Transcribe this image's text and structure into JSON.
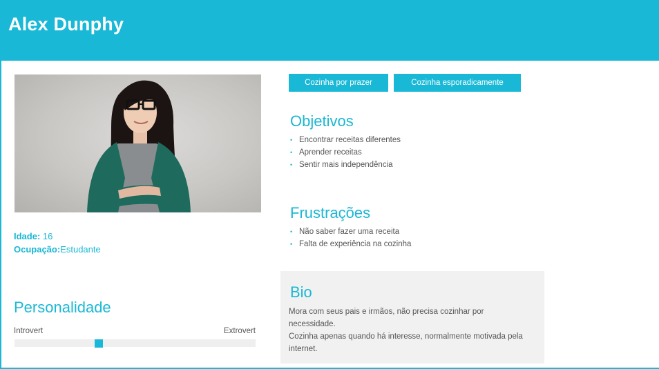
{
  "persona": {
    "name": "Alex Dunphy",
    "age_label": "Idade:",
    "age_value": " 16",
    "occupation_label": "Ocupação:",
    "occupation_value": "Estudante"
  },
  "tags": [
    "Cozinha por prazer",
    "Cozinha esporadicamente"
  ],
  "goals": {
    "title": "Objetivos",
    "items": [
      "Encontrar receitas diferentes",
      "Aprender receitas",
      "Sentir mais independência"
    ]
  },
  "frustrations": {
    "title": "Frustrações",
    "items": [
      "Não saber fazer uma receita",
      "Falta de experiência na cozinha"
    ]
  },
  "bio": {
    "title": "Bio",
    "line1": "Mora com seus pais e irmãos, não precisa cozinhar por necessidade.",
    "line2": "Cozinha apenas quando há interesse, normalmente motivada pela internet."
  },
  "personality": {
    "title": "Personalidade",
    "left_label": "Introvert",
    "right_label": "Extrovert",
    "level": 0.35
  },
  "colors": {
    "accent": "#19b8d6",
    "panel": "#f1f1f1",
    "text": "#555555"
  }
}
